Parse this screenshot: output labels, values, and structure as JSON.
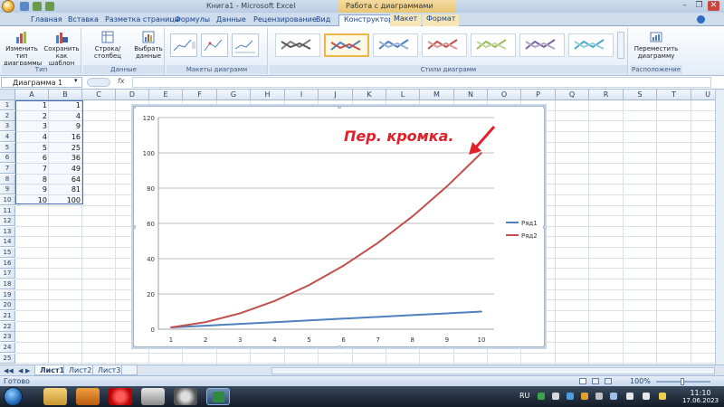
{
  "window": {
    "title": "Книга1 - Microsoft Excel",
    "context_title": "Работа с диаграммами"
  },
  "tabs": [
    "Главная",
    "Вставка",
    "Разметка страницы",
    "Формулы",
    "Данные",
    "Рецензирование",
    "Вид",
    "Конструктор",
    "Макет",
    "Формат"
  ],
  "active_tab": "Конструктор",
  "ribbon": {
    "type_group": {
      "label": "Тип",
      "change_type": "Изменить тип диаграммы",
      "save_template": "Сохранить как шаблон"
    },
    "data_group": {
      "label": "Данные",
      "switch_row_col": "Строка/столбец",
      "select_data": "Выбрать данные"
    },
    "layouts_group": {
      "label": "Макеты диаграмм"
    },
    "styles_group": {
      "label": "Стили диаграмм"
    },
    "location_group": {
      "label": "Расположение",
      "move_chart": "Переместить диаграмму"
    }
  },
  "formula_bar": {
    "name_box": "Диаграмма 1",
    "fx": "fx",
    "value": ""
  },
  "columns": [
    "A",
    "B",
    "C",
    "D",
    "E",
    "F",
    "G",
    "H",
    "I",
    "J",
    "K",
    "L",
    "M",
    "N",
    "O",
    "P",
    "Q",
    "R",
    "S",
    "T",
    "U"
  ],
  "rows": [
    "1",
    "2",
    "3",
    "4",
    "5",
    "6",
    "7",
    "8",
    "9",
    "10",
    "11",
    "12",
    "13",
    "14",
    "15",
    "16",
    "17",
    "18",
    "19",
    "20",
    "21",
    "22",
    "23",
    "24",
    "25"
  ],
  "cells": {
    "A": [
      "1",
      "2",
      "3",
      "4",
      "5",
      "6",
      "7",
      "8",
      "9",
      "10"
    ],
    "B": [
      "1",
      "4",
      "9",
      "16",
      "25",
      "36",
      "49",
      "64",
      "81",
      "100"
    ]
  },
  "chart_data": {
    "type": "line",
    "x": [
      1,
      2,
      3,
      4,
      5,
      6,
      7,
      8,
      9,
      10
    ],
    "series": [
      {
        "name": "Ряд1",
        "values": [
          1,
          2,
          3,
          4,
          5,
          6,
          7,
          8,
          9,
          10
        ],
        "color": "#4f81bd"
      },
      {
        "name": "Ряд2",
        "values": [
          1,
          4,
          9,
          16,
          25,
          36,
          49,
          64,
          81,
          100
        ],
        "color": "#c0504d"
      }
    ],
    "yticks": [
      0,
      20,
      40,
      60,
      80,
      100,
      120
    ],
    "ylim": [
      0,
      120
    ],
    "grid": true,
    "legend": "right",
    "annotation": {
      "text": "Пер. кромка.",
      "color": "#e0202a"
    }
  },
  "sheet_tabs": [
    "Лист1",
    "Лист2",
    "Лист3"
  ],
  "active_sheet": "Лист1",
  "status": {
    "text": "Готово",
    "zoom": "100%"
  },
  "taskbar": {
    "lang": "RU",
    "time": "11:10",
    "date": "17.06.2023"
  },
  "colors": {
    "accent": "#15428b",
    "selected_style": "#f0b548"
  }
}
